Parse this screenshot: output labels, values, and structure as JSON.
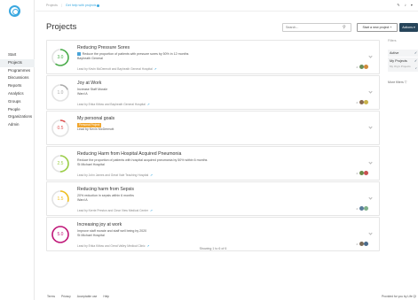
{
  "sidebar": {
    "items": [
      {
        "label": "Start",
        "active": false
      },
      {
        "label": "Projects",
        "active": true
      },
      {
        "label": "Programmes",
        "active": false
      },
      {
        "label": "Discussions",
        "active": false
      },
      {
        "label": "Reports",
        "active": false
      },
      {
        "label": "Analytics",
        "active": false
      },
      {
        "label": "Groups",
        "active": false
      },
      {
        "label": "People",
        "active": false
      },
      {
        "label": "Organizations",
        "active": false
      },
      {
        "label": "Admin",
        "active": false
      }
    ]
  },
  "breadcrumb": {
    "root": "Projects",
    "help": "Get help with projects"
  },
  "page_title": "Projects",
  "search": {
    "placeholder": "Search...",
    "icon": "search-icon"
  },
  "toolbar": {
    "new_project": "Start a new project +",
    "actions": "Actions ▾"
  },
  "projects": [
    {
      "title": "Reducing Pressure Sores",
      "score": "3.0",
      "score_color": "#4cae4c",
      "fill": 0.6,
      "line1": "Reduce the proportion of patients with pressure sores by 50% in 12 months",
      "line1_tag": true,
      "line2": "Bayheath General",
      "lead": "Lead by Kevin McDermott and Bayheath General Hospital",
      "avatars": [
        "#6b8e5a",
        "#d08a3a"
      ]
    },
    {
      "title": "Joy at Work",
      "score": "1.0",
      "score_color": "#a9a9a9",
      "fill": 0.18,
      "line1": "Increase Staff Morale",
      "line1_tag": false,
      "line2": "Ward A",
      "lead": "Lead by Erika Kittow and Bayheath General Hospital",
      "avatars": [
        "#8a6b4f",
        "#c9b24a"
      ]
    },
    {
      "title": "My personal goals",
      "score": "0.5",
      "score_color": "#e05656",
      "fill": 0.1,
      "badge": "Personal Project",
      "line1": "",
      "line1_tag": false,
      "line2": "Lead by Kevin McDermott",
      "lead": "",
      "avatars": []
    },
    {
      "title": "Reducing Harm from Hospital Acquired Pneumonia",
      "score": "2.5",
      "score_color": "#9ccf48",
      "fill": 0.5,
      "line1": "Reduce the proportion of patients with hospital acquired pneumonia by 50% within 6 months",
      "line1_tag": false,
      "line2": "St Michael Hospital",
      "lead": "Lead by John James and Great Vale Teaching Hospital",
      "avatars": [
        "#6c8a4a",
        "#c85050"
      ]
    },
    {
      "title": "Reducing harm from Sepsis",
      "score": "1.5",
      "score_color": "#f0c020",
      "fill": 0.3,
      "line1": "20% reduction in sepsis within 6 months",
      "line1_tag": false,
      "line2": "Ward A",
      "lead": "Lead by Kerrie Preston and Clear View Medical Center",
      "avatars": [
        "#5a7d9a",
        "#7fb08a"
      ]
    },
    {
      "title": "Increasing joy at work",
      "score": "5.0",
      "score_color": "#c2187a",
      "fill": 1.0,
      "line1": "Improve staff morale and staff well being by 2020",
      "line1_tag": false,
      "line2": "St Michael Hospital",
      "lead": "Lead by Erika Kittow and Great Valley Medical Clinic",
      "avatars": [
        "#7a6a58",
        "#4a6a8a"
      ]
    }
  ],
  "showing": "Showing 1 to 6 of 6",
  "filters": {
    "title": "Filters",
    "items": [
      {
        "label": "Active",
        "checked": true
      },
      {
        "label": "My Projects",
        "checked": true
      },
      {
        "label": "My Org's Projects",
        "checked": true
      }
    ],
    "more": "More filters ▽"
  },
  "footer": {
    "links": [
      "Terms",
      "Privacy",
      "Acceptable use",
      "Help"
    ],
    "brand": "Provided for you by Life QI"
  }
}
